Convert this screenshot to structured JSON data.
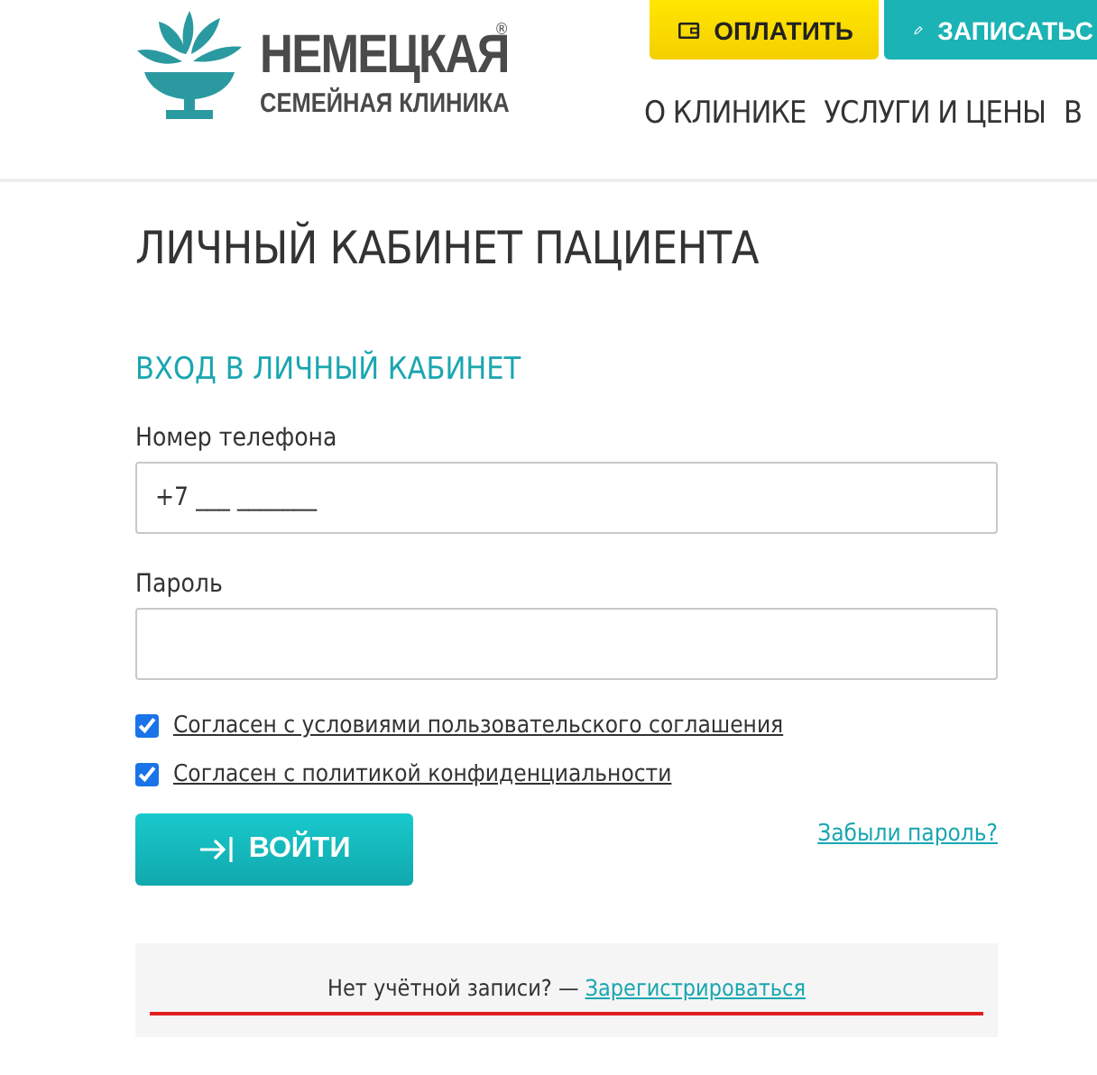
{
  "header": {
    "logo": {
      "name": "НЕМЕЦКАЯ",
      "tagline": "СЕМЕЙНАЯ КЛИНИКА",
      "mark": "®"
    },
    "actions": [
      {
        "kind": "pay",
        "label": "ОПЛАТИТЬ"
      },
      {
        "kind": "book",
        "label": "ЗАПИСАТЬС"
      }
    ],
    "nav": [
      "О КЛИНИКЕ",
      "УСЛУГИ И ЦЕНЫ",
      "В"
    ]
  },
  "page_title": "ЛИЧНЫЙ КАБИНЕТ ПАЦИЕНТА",
  "form": {
    "title": "ВХОД В ЛИЧНЫЙ КАБИНЕТ",
    "fields": [
      {
        "label": "Номер телефона",
        "value": "+7 ___ _______"
      },
      {
        "label": "Пароль"
      }
    ],
    "agreements": [
      {
        "label": "Согласен с условиями пользовательского соглашения",
        "checked": true
      },
      {
        "label": "Согласен с политикой конфиденциальности",
        "checked": true
      }
    ],
    "submit": "ВОЙТИ",
    "forgot": "Забыли пароль?"
  },
  "register": {
    "text": "Нет учётной записи? —",
    "link": "Зарегистрироваться"
  }
}
